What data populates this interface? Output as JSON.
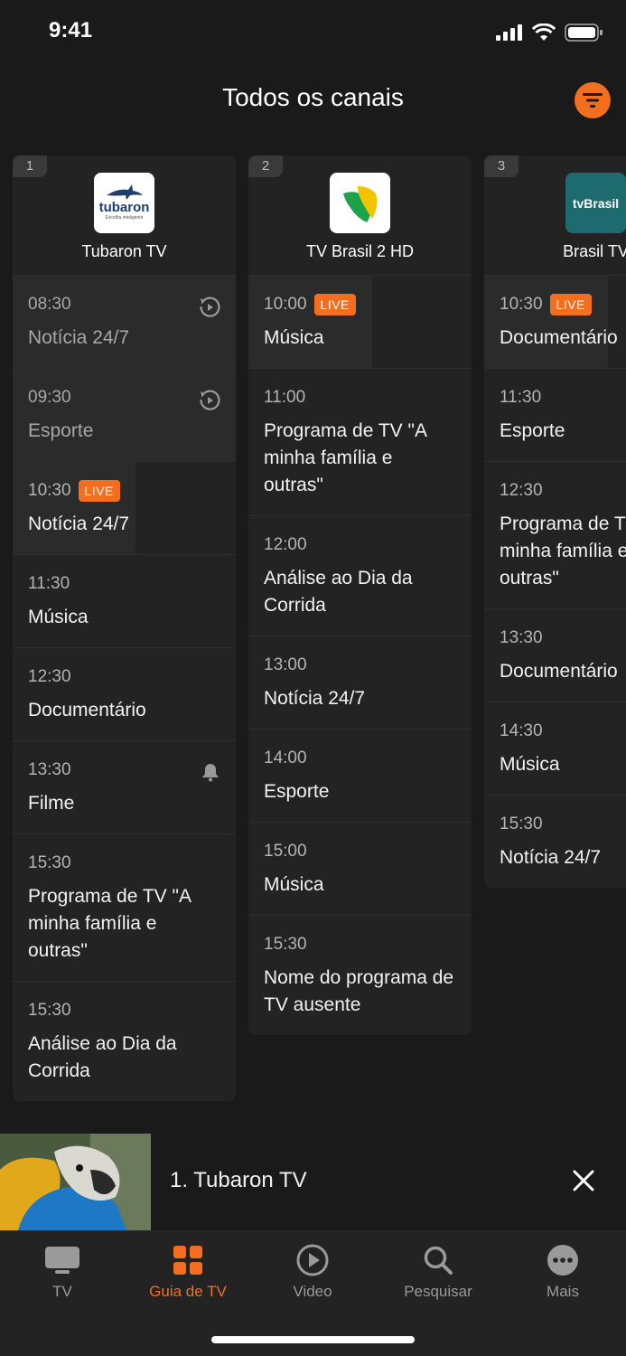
{
  "status_bar": {
    "time": "9:41"
  },
  "header": {
    "title": "Todos os canais"
  },
  "channels": [
    {
      "number": "1",
      "name": "Tubaron TV",
      "logo_text": "tubaron",
      "logo_subtext": "Escolha inteligente",
      "programs": [
        {
          "time": "08:30",
          "title": "Notícia 24/7",
          "icon": "replay-icon"
        },
        {
          "time": "09:30",
          "title": "Esporte",
          "icon": "replay-icon"
        },
        {
          "time": "10:30",
          "title": "Notícia 24/7",
          "badge": "LIVE"
        },
        {
          "time": "11:30",
          "title": "Música"
        },
        {
          "time": "12:30",
          "title": "Documentário"
        },
        {
          "time": "13:30",
          "title": "Filme",
          "icon": "reminder-bell-icon"
        },
        {
          "time": "15:30",
          "title": "Programa de TV \"A minha família e outras\""
        },
        {
          "time": "15:30",
          "title": "Análise ao Dia da Corrida"
        }
      ]
    },
    {
      "number": "2",
      "name": "TV Brasil 2 HD",
      "programs": [
        {
          "time": "10:00",
          "title": "Música",
          "badge": "LIVE"
        },
        {
          "time": "11:00",
          "title": "Programa de TV \"A minha família e outras\""
        },
        {
          "time": "12:00",
          "title": "Análise ao Dia da Corrida"
        },
        {
          "time": "13:00",
          "title": "Notícia 24/7"
        },
        {
          "time": "14:00",
          "title": "Esporte"
        },
        {
          "time": "15:00",
          "title": "Música"
        },
        {
          "time": "15:30",
          "title": "Nome do programa de TV ausente"
        }
      ]
    },
    {
      "number": "3",
      "name": "Brasil TV",
      "logo_text": "tvBrasil",
      "programs": [
        {
          "time": "10:30",
          "title": "Documentário",
          "badge": "LIVE"
        },
        {
          "time": "11:30",
          "title": "Esporte"
        },
        {
          "time": "12:30",
          "title": "Programa de TV \"A minha família e outras\""
        },
        {
          "time": "13:30",
          "title": "Documentário"
        },
        {
          "time": "14:30",
          "title": "Música"
        },
        {
          "time": "15:30",
          "title": "Notícia 24/7"
        }
      ]
    }
  ],
  "mini_player": {
    "title": "1. Tubaron TV"
  },
  "tabs": [
    {
      "label": "TV",
      "icon": "tv-icon"
    },
    {
      "label": "Guia de TV",
      "icon": "grid-icon",
      "active": true
    },
    {
      "label": "Video",
      "icon": "play-circle-icon"
    },
    {
      "label": "Pesquisar",
      "icon": "search-icon"
    },
    {
      "label": "Mais",
      "icon": "more-icon"
    }
  ],
  "colors": {
    "accent": "#f46e1f",
    "background": "#1a1a1a",
    "card": "#232323"
  }
}
